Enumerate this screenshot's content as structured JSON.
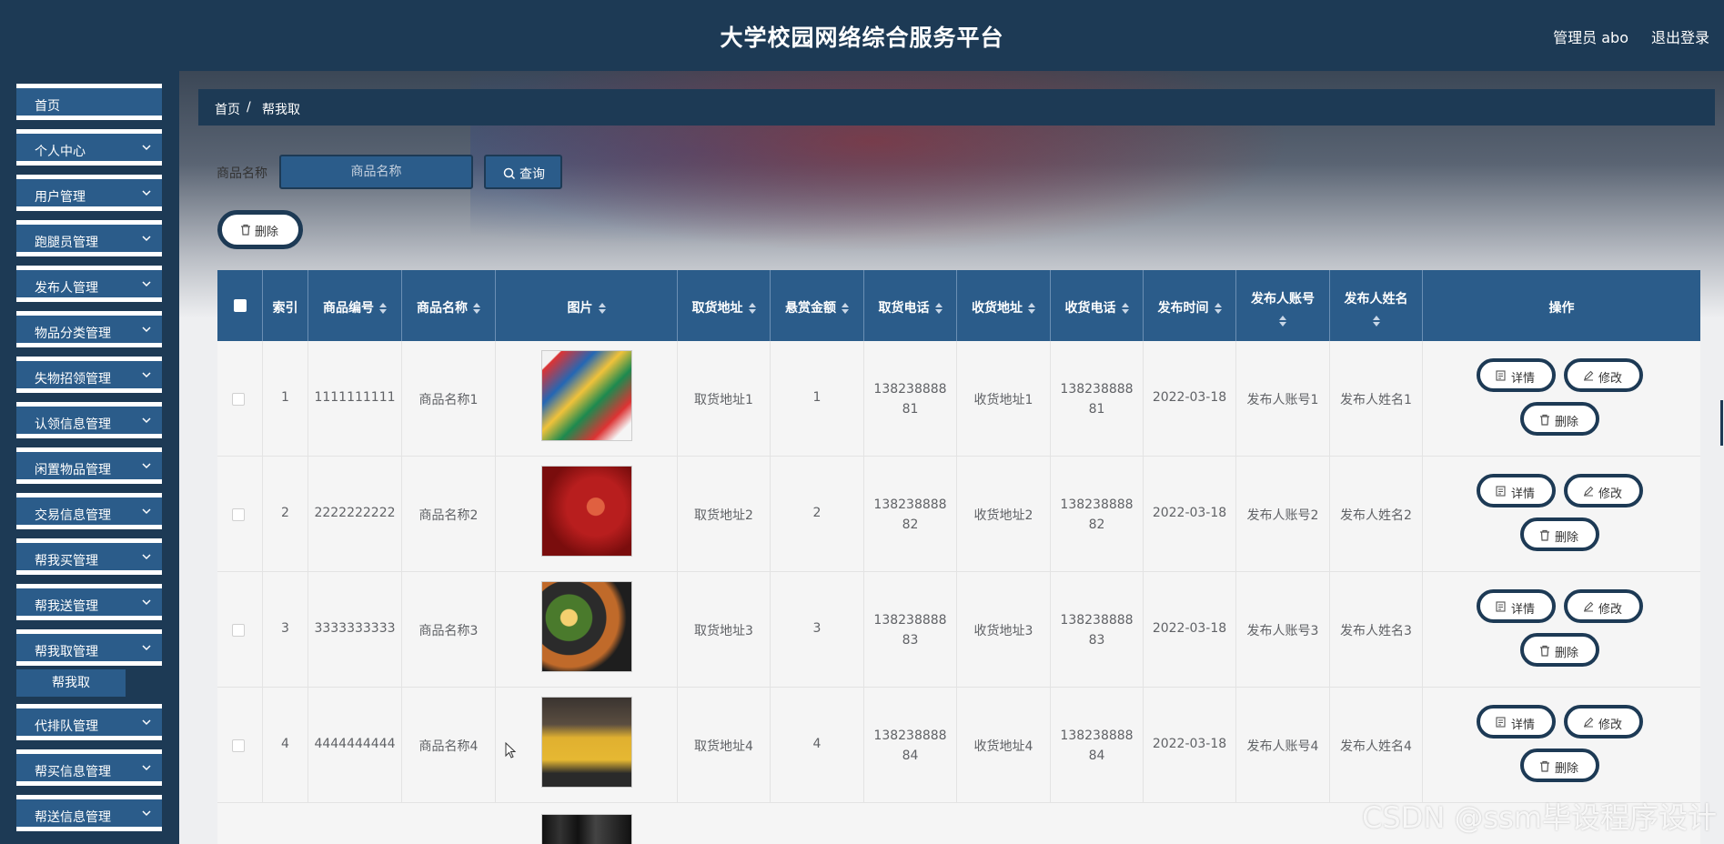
{
  "header": {
    "title": "大学校园网络综合服务平台",
    "user": "管理员 abo",
    "logout": "退出登录"
  },
  "sidebar": {
    "items": [
      {
        "label": "首页",
        "has_children": false
      },
      {
        "label": "个人中心",
        "has_children": true
      },
      {
        "label": "用户管理",
        "has_children": true
      },
      {
        "label": "跑腿员管理",
        "has_children": true
      },
      {
        "label": "发布人管理",
        "has_children": true
      },
      {
        "label": "物品分类管理",
        "has_children": true
      },
      {
        "label": "失物招领管理",
        "has_children": true
      },
      {
        "label": "认领信息管理",
        "has_children": true
      },
      {
        "label": "闲置物品管理",
        "has_children": true
      },
      {
        "label": "交易信息管理",
        "has_children": true
      },
      {
        "label": "帮我买管理",
        "has_children": true
      },
      {
        "label": "帮我送管理",
        "has_children": true
      },
      {
        "label": "帮我取管理",
        "has_children": true
      },
      {
        "label": "代排队管理",
        "has_children": true
      },
      {
        "label": "帮买信息管理",
        "has_children": true
      },
      {
        "label": "帮送信息管理",
        "has_children": true
      }
    ],
    "submenu": {
      "label": "帮我取"
    }
  },
  "breadcrumb": {
    "home": "首页",
    "sep": "/",
    "current": "帮我取"
  },
  "search": {
    "label": "商品名称",
    "placeholder": "商品名称",
    "button": "查询"
  },
  "bulk_delete": "删除",
  "table": {
    "columns": [
      "索引",
      "商品编号",
      "商品名称",
      "图片",
      "取货地址",
      "悬赏金额",
      "取货电话",
      "收货地址",
      "收货电话",
      "发布时间",
      "发布人账号",
      "发布人姓名",
      "操作"
    ],
    "rows": [
      {
        "index": "1",
        "code": "1111111111",
        "name": "商品名称1",
        "pickup_addr": "取货地址1",
        "reward": "1",
        "pickup_phone_a": "138238888",
        "pickup_phone_b": "81",
        "recv_addr": "收货地址1",
        "recv_phone_a": "138238888",
        "recv_phone_b": "81",
        "time": "2022-03-18",
        "account": "发布人账号1",
        "publisher": "发布人姓名1"
      },
      {
        "index": "2",
        "code": "2222222222",
        "name": "商品名称2",
        "pickup_addr": "取货地址2",
        "reward": "2",
        "pickup_phone_a": "138238888",
        "pickup_phone_b": "82",
        "recv_addr": "收货地址2",
        "recv_phone_a": "138238888",
        "recv_phone_b": "82",
        "time": "2022-03-18",
        "account": "发布人账号2",
        "publisher": "发布人姓名2"
      },
      {
        "index": "3",
        "code": "3333333333",
        "name": "商品名称3",
        "pickup_addr": "取货地址3",
        "reward": "3",
        "pickup_phone_a": "138238888",
        "pickup_phone_b": "83",
        "recv_addr": "收货地址3",
        "recv_phone_a": "138238888",
        "recv_phone_b": "83",
        "time": "2022-03-18",
        "account": "发布人账号3",
        "publisher": "发布人姓名3"
      },
      {
        "index": "4",
        "code": "4444444444",
        "name": "商品名称4",
        "pickup_addr": "取货地址4",
        "reward": "4",
        "pickup_phone_a": "138238888",
        "pickup_phone_b": "84",
        "recv_addr": "收货地址4",
        "recv_phone_a": "138238888",
        "recv_phone_b": "84",
        "time": "2022-03-18",
        "account": "发布人账号4",
        "publisher": "发布人姓名4"
      }
    ],
    "actions": {
      "detail": "详情",
      "edit": "修改",
      "delete": "删除"
    }
  },
  "watermark": "CSDN @ssm毕设程序设计",
  "colors": {
    "primary": "#1d3a55",
    "accent": "#2b5c8a"
  }
}
